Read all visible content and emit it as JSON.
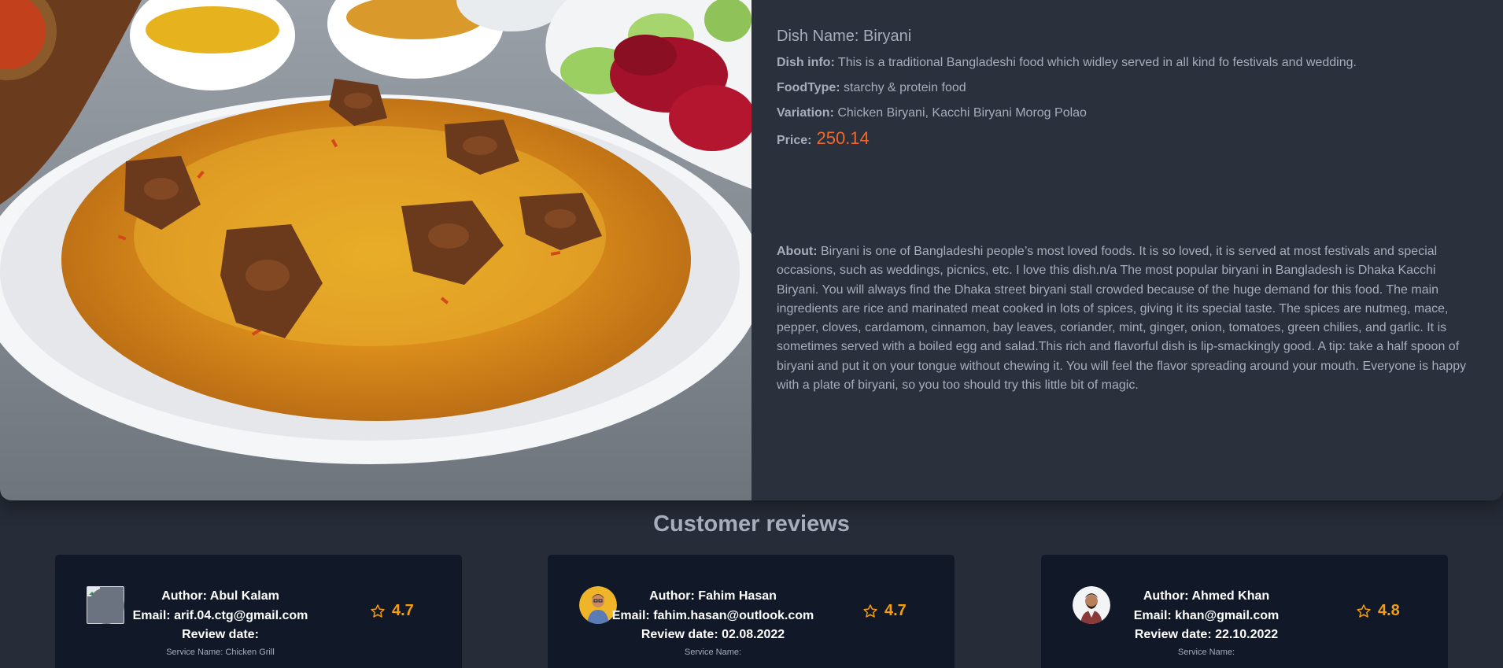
{
  "dish": {
    "name_label": "Dish Name: Biryani",
    "info_label": "Dish info:",
    "info_value": " This is a traditional Bangladeshi food which widley served in all kind fo festivals and wedding.",
    "foodtype_label": "FoodType:",
    "foodtype_value": " starchy & protein food",
    "variation_label": "Variation:",
    "variation_value": " Chicken Biryani, Kacchi Biryani Morog Polao",
    "price_label": "Price:",
    "price_value": "250.14",
    "about_label": "About:",
    "about_value": " Biryani is one of Bangladeshi people’s most loved foods. It is so loved, it is served at most festivals and special occasions, such as weddings, picnics, etc. I love this dish.n/a The most popular biryani in Bangladesh is Dhaka Kacchi Biryani. You will always find the Dhaka street biryani stall crowded because of the huge demand for this food. The main ingredients are rice and marinated meat cooked in lots of spices, giving it its special taste. The spices are nutmeg, mace, pepper, cloves, cardamom, cinnamon, bay leaves, coriander, mint, ginger, onion, tomatoes, green chilies, and garlic. It is sometimes served with a boiled egg and salad.This rich and flavorful dish is lip-smackingly good. A tip: take a half spoon of biryani and put it on your tongue without chewing it. You will feel the flavor spreading around your mouth. Everyone is happy with a plate of biryani, so you too should try this little bit of magic."
  },
  "reviews": {
    "title": "Customer reviews",
    "items": [
      {
        "author": "Author: Abul Kalam",
        "email": "Email: arif.04.ctg@gmail.com",
        "date": "Review date:",
        "service": "Service Name: Chicken Grill",
        "rating": "4.7",
        "avatar": "broken-image-icon"
      },
      {
        "author": "Author: Fahim Hasan",
        "email": "Email: fahim.hasan@outlook.com",
        "date": "Review date: 02.08.2022",
        "service": "Service Name:",
        "rating": "4.7",
        "avatar": "user-avatar"
      },
      {
        "author": "Author: Ahmed Khan",
        "email": "Email: khan@gmail.com",
        "date": "Review date: 22.10.2022",
        "service": "Service Name:",
        "rating": "4.8",
        "avatar": "user-avatar"
      }
    ]
  },
  "colors": {
    "page_bg": "#262c38",
    "panel_bg": "#2a303c",
    "card_bg": "#111827",
    "price": "#f1682a",
    "rating": "#f59e0b"
  }
}
